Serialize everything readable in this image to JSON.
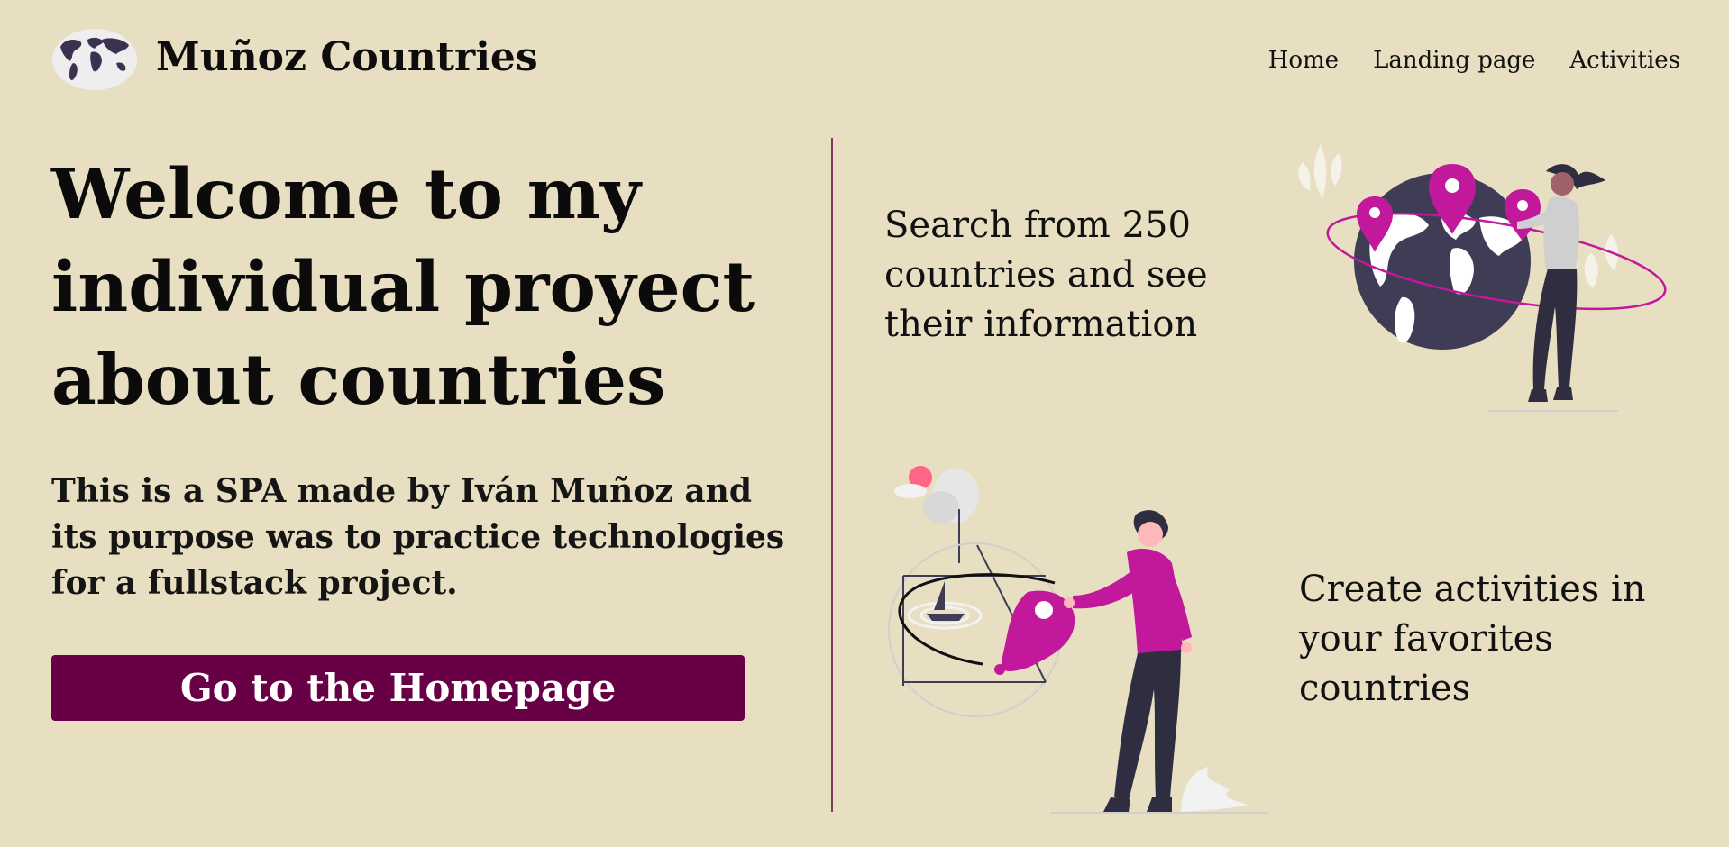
{
  "header": {
    "brand": "Muñoz Countries",
    "logo_icon": "world-map-icon",
    "nav": [
      {
        "label": "Home"
      },
      {
        "label": "Landing page"
      },
      {
        "label": "Activities"
      }
    ]
  },
  "hero": {
    "title": "Welcome to my individual proyect about countries",
    "description": "This is a SPA made by Iván Muñoz and its purpose was to practice technologies for a fullstack project.",
    "cta_label": "Go to the Homepage"
  },
  "features": [
    {
      "text": "Search from 250 countries and see their information",
      "illustration": "globe-with-map-pins-illustration"
    },
    {
      "text": "Create activities in your favorites countries",
      "illustration": "person-placing-map-pin-illustration"
    }
  ],
  "colors": {
    "background": "#e8dec1",
    "accent": "#680046",
    "pin": "#c2189b",
    "divider": "#7a3a5a"
  }
}
